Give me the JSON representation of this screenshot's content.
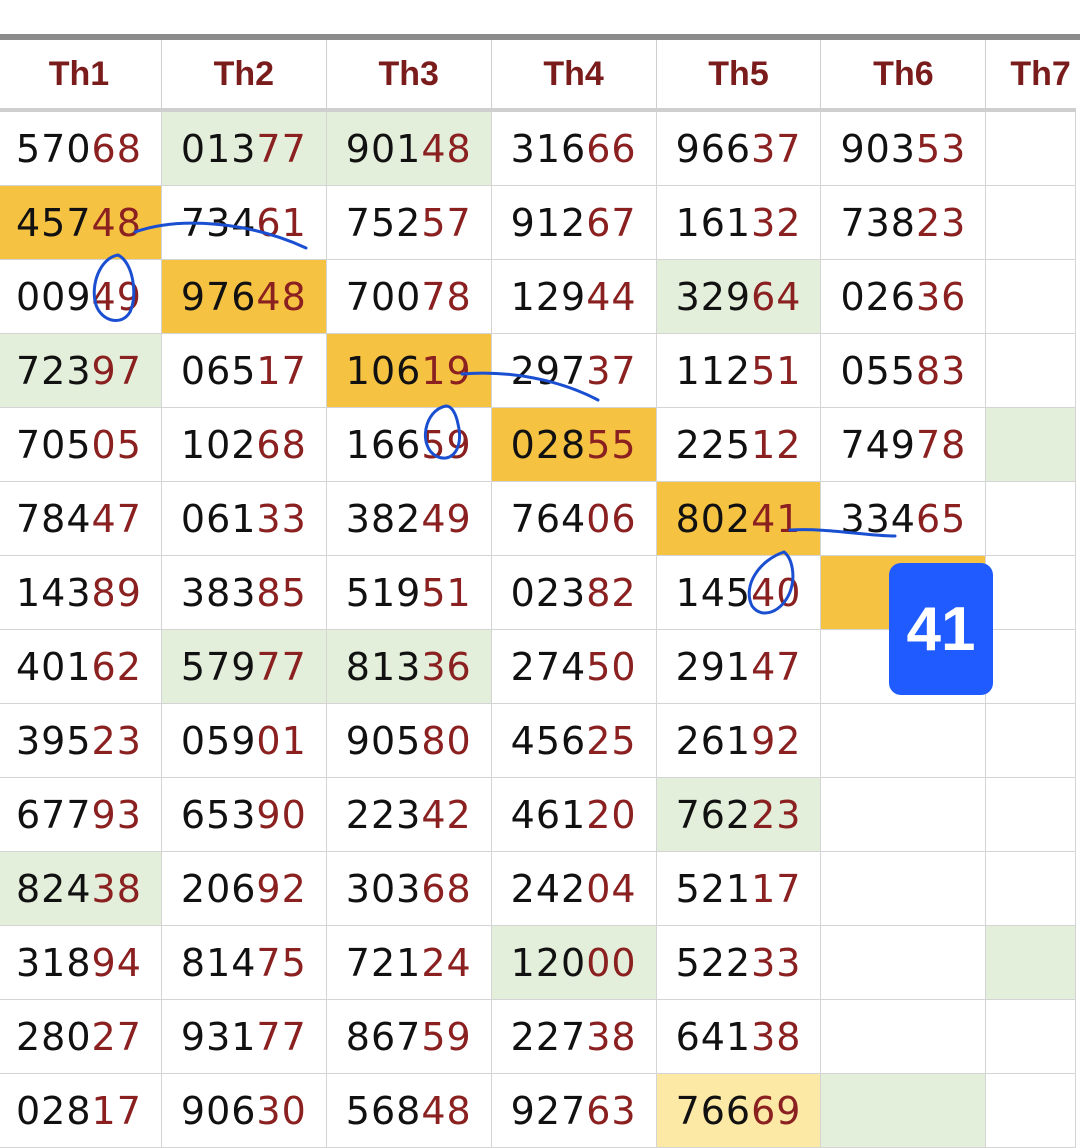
{
  "headers": [
    "Th1",
    "Th2",
    "Th3",
    "Th4",
    "Th5",
    "Th6",
    "Th7"
  ],
  "columns": [
    [
      {
        "v": "57068"
      },
      {
        "v": "45748",
        "bg": "orange"
      },
      {
        "v": "00949"
      },
      {
        "v": "72397",
        "bg": "green"
      },
      {
        "v": "70505"
      },
      {
        "v": "78447"
      },
      {
        "v": "14389"
      },
      {
        "v": "40162"
      },
      {
        "v": "39523"
      },
      {
        "v": "67793"
      },
      {
        "v": "82438",
        "bg": "green"
      },
      {
        "v": "31894"
      },
      {
        "v": "28027"
      },
      {
        "v": "02817"
      }
    ],
    [
      {
        "v": "01377",
        "bg": "green"
      },
      {
        "v": "73461"
      },
      {
        "v": "97648",
        "bg": "orange"
      },
      {
        "v": "06517"
      },
      {
        "v": "10268"
      },
      {
        "v": "06133"
      },
      {
        "v": "38385"
      },
      {
        "v": "57977",
        "bg": "green"
      },
      {
        "v": "05901"
      },
      {
        "v": "65390"
      },
      {
        "v": "20692"
      },
      {
        "v": "81475"
      },
      {
        "v": "93177"
      },
      {
        "v": "90630"
      }
    ],
    [
      {
        "v": "90148",
        "bg": "green"
      },
      {
        "v": "75257"
      },
      {
        "v": "70078"
      },
      {
        "v": "10619",
        "bg": "orange"
      },
      {
        "v": "16659"
      },
      {
        "v": "38249"
      },
      {
        "v": "51951"
      },
      {
        "v": "81336",
        "bg": "green"
      },
      {
        "v": "90580"
      },
      {
        "v": "22342"
      },
      {
        "v": "30368"
      },
      {
        "v": "72124"
      },
      {
        "v": "86759"
      },
      {
        "v": "56848"
      }
    ],
    [
      {
        "v": "31666"
      },
      {
        "v": "91267"
      },
      {
        "v": "12944"
      },
      {
        "v": "29737"
      },
      {
        "v": "02855",
        "bg": "orange"
      },
      {
        "v": "76406"
      },
      {
        "v": "02382"
      },
      {
        "v": "27450"
      },
      {
        "v": "45625"
      },
      {
        "v": "46120"
      },
      {
        "v": "24204"
      },
      {
        "v": "12000",
        "bg": "green"
      },
      {
        "v": "22738"
      },
      {
        "v": "92763"
      }
    ],
    [
      {
        "v": "96637"
      },
      {
        "v": "16132"
      },
      {
        "v": "32964",
        "bg": "green"
      },
      {
        "v": "11251"
      },
      {
        "v": "22512"
      },
      {
        "v": "80241",
        "bg": "orange"
      },
      {
        "v": "14540"
      },
      {
        "v": "29147"
      },
      {
        "v": "26192"
      },
      {
        "v": "76223",
        "bg": "green"
      },
      {
        "v": "52117"
      },
      {
        "v": "52233"
      },
      {
        "v": "64138"
      },
      {
        "v": "76669",
        "bg": "yellow"
      }
    ],
    [
      {
        "v": "90353"
      },
      {
        "v": "73823"
      },
      {
        "v": "02636"
      },
      {
        "v": "05583"
      },
      {
        "v": "74978"
      },
      {
        "v": "33465"
      },
      {
        "v": "",
        "bg": "orange"
      },
      {
        "v": ""
      },
      {
        "v": ""
      },
      {
        "v": ""
      },
      {
        "v": ""
      },
      {
        "v": ""
      },
      {
        "v": ""
      },
      {
        "v": "",
        "bg": "green"
      }
    ],
    [
      {
        "v": ""
      },
      {
        "v": ""
      },
      {
        "v": ""
      },
      {
        "v": ""
      },
      {
        "v": "",
        "bg": "green"
      },
      {
        "v": ""
      },
      {
        "v": ""
      },
      {
        "v": ""
      },
      {
        "v": ""
      },
      {
        "v": ""
      },
      {
        "v": ""
      },
      {
        "v": "",
        "bg": "green"
      },
      {
        "v": ""
      },
      {
        "v": ""
      }
    ]
  ],
  "badge": {
    "label": "41"
  },
  "colors": {
    "header_text": "#7b1c1c",
    "suffix_text": "#8b2020",
    "green": "#e3efdb",
    "orange": "#f6c242",
    "yellow": "#fde9a6",
    "badge": "#1f5bff",
    "ink": "#1a4fd1"
  }
}
